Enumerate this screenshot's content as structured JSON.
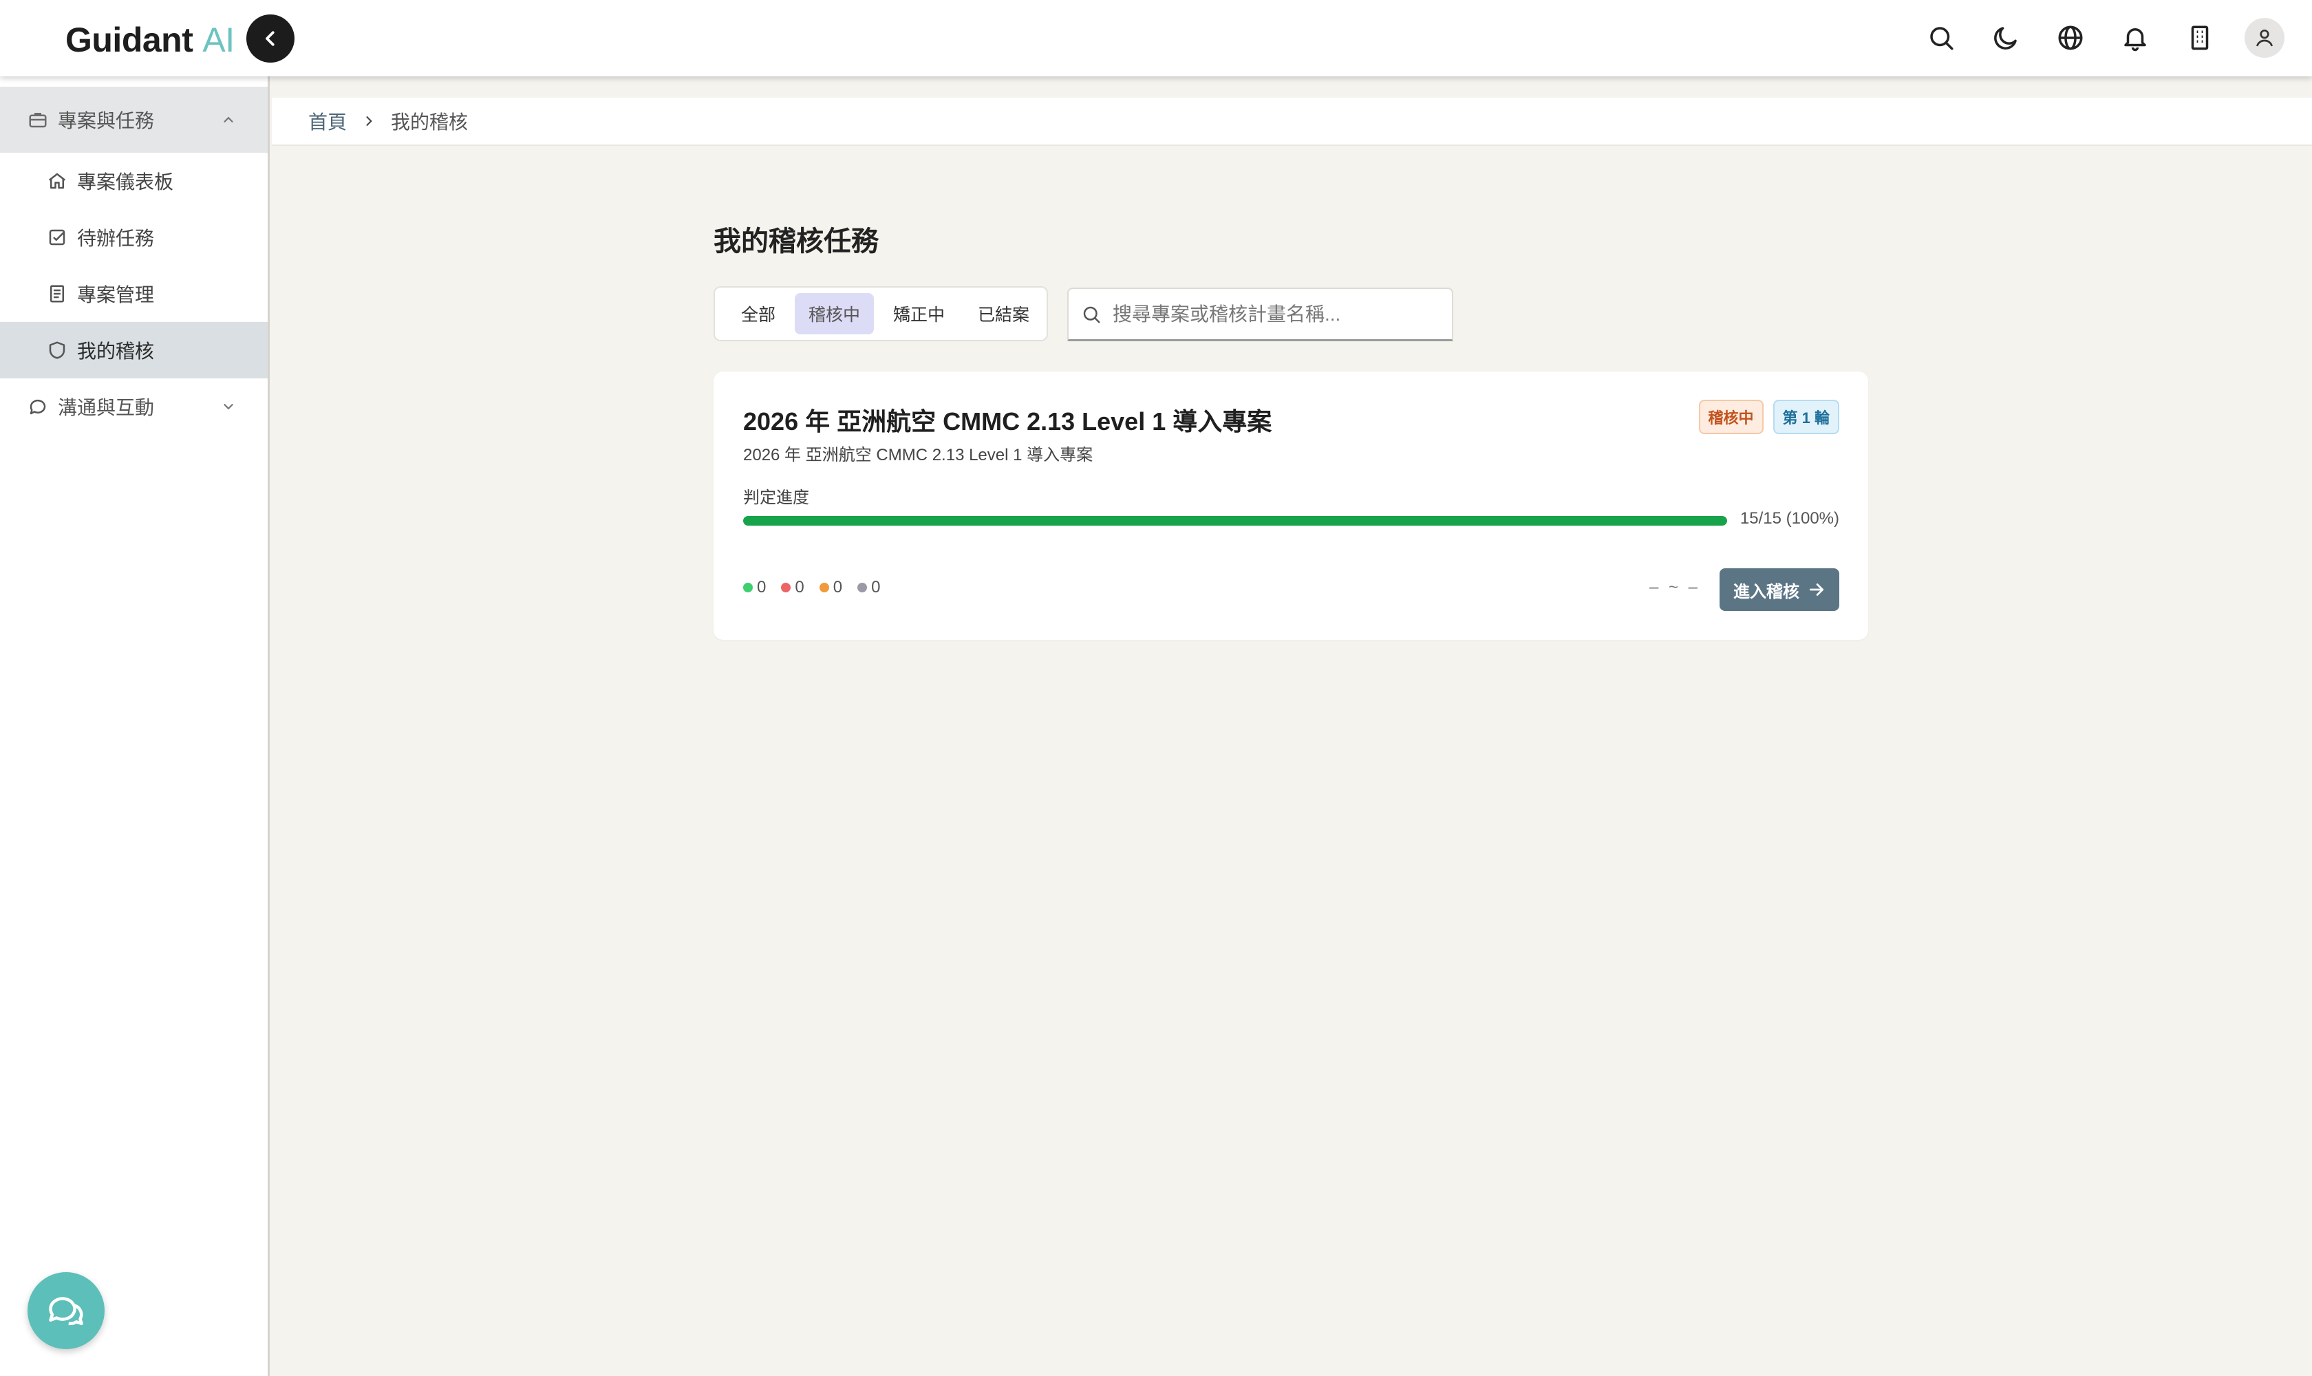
{
  "app": {
    "logo_main": "Guidant",
    "logo_accent": "AI"
  },
  "topbar": {
    "icons": [
      "search-icon",
      "moon-icon",
      "globe-icon",
      "bell-icon",
      "building-icon",
      "user-icon"
    ]
  },
  "sidebar": {
    "groups": [
      {
        "label": "專案與任務",
        "icon": "briefcase-icon",
        "expanded": true,
        "items": [
          {
            "label": "專案儀表板",
            "icon": "home-icon"
          },
          {
            "label": "待辦任務",
            "icon": "checkbox-icon"
          },
          {
            "label": "專案管理",
            "icon": "document-icon"
          },
          {
            "label": "我的稽核",
            "icon": "shield-icon",
            "active": true
          }
        ]
      },
      {
        "label": "溝通與互動",
        "icon": "chat-icon",
        "expanded": false
      }
    ]
  },
  "breadcrumb": {
    "home": "首頁",
    "current": "我的稽核"
  },
  "main": {
    "title": "我的稽核任務",
    "tabs": [
      {
        "label": "全部"
      },
      {
        "label": "稽核中",
        "active": true
      },
      {
        "label": "矯正中"
      },
      {
        "label": "已結案"
      }
    ],
    "search_placeholder": "搜尋專案或稽核計畫名稱..."
  },
  "card": {
    "title": "2026 年 亞洲航空 CMMC 2.13 Level 1 導入專案",
    "subtitle": "2026 年 亞洲航空 CMMC 2.13 Level 1 導入專案",
    "status_badge": "稽核中",
    "round_badge": "第 1 輪",
    "progress_label": "判定進度",
    "progress_fraction": 1.0,
    "progress_text": "15/15 (100%)",
    "counts": [
      {
        "value": "0",
        "color": "#3ecf6e"
      },
      {
        "value": "0",
        "color": "#ec6464"
      },
      {
        "value": "0",
        "color": "#f09a3a"
      },
      {
        "value": "0",
        "color": "#9a9aa6"
      }
    ],
    "date_range": "– ~ –",
    "action_label": "進入稽核"
  },
  "colors": {
    "accent": "#6cc3bf",
    "progress": "#17a34a",
    "button": "#5c7585"
  }
}
